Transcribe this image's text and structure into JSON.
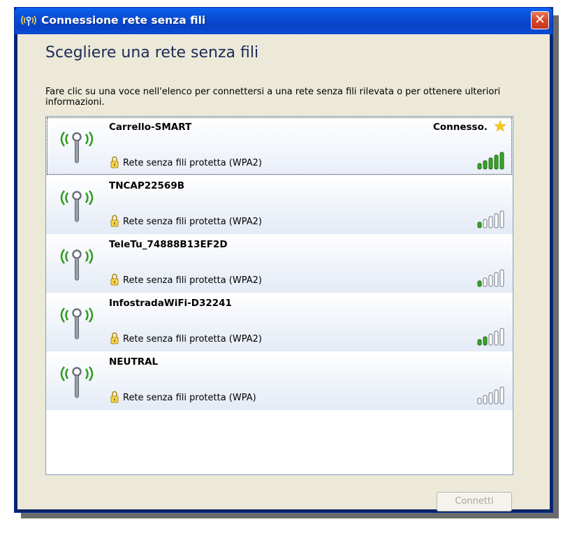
{
  "window": {
    "title": "Connessione rete senza fili",
    "title_icon": "wireless-icon",
    "close_icon": "close-icon"
  },
  "header": {
    "heading": "Scegliere una rete senza fili",
    "description": "Fare clic su una voce nell'elenco per connettersi a una rete senza fili rilevata o per ottenere ulteriori informazioni."
  },
  "networks": [
    {
      "ssid": "Carrello-SMART",
      "security": "Rete senza fili protetta (WPA2)",
      "status": "Connesso.",
      "signal_bars": 5,
      "selected": true
    },
    {
      "ssid": "TNCAP22569B",
      "security": "Rete senza fili protetta (WPA2)",
      "status": "",
      "signal_bars": 1
    },
    {
      "ssid": "TeleTu_74888B13EF2D",
      "security": "Rete senza fili protetta (WPA2)",
      "status": "",
      "signal_bars": 1
    },
    {
      "ssid": "InfostradaWiFi-D32241",
      "security": "Rete senza fili protetta (WPA2)",
      "status": "",
      "signal_bars": 2
    },
    {
      "ssid": "NEUTRAL",
      "security": "Rete senza fili protetta (WPA)",
      "status": "",
      "signal_bars": 0
    }
  ],
  "actions": {
    "connect_label": "Connetti"
  },
  "colors": {
    "signal_on": "#3aa32a",
    "signal_off": "#ffffff",
    "antenna_waves": "#2f9a1d",
    "title_bar": "#0a50d8"
  }
}
